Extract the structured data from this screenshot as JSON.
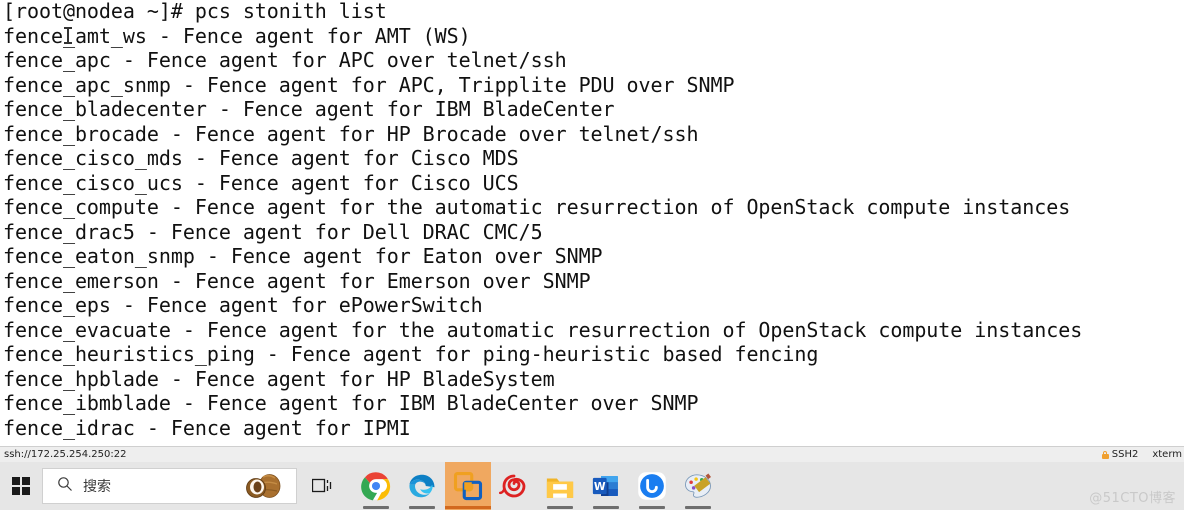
{
  "terminal": {
    "prompt_line": "[root@nodea ~]# pcs stonith list",
    "lines": [
      "[root@nodea ~]# pcs stonith list",
      "fence_amt_ws - Fence agent for AMT (WS)",
      "fence_apc - Fence agent for APC over telnet/ssh",
      "fence_apc_snmp - Fence agent for APC, Tripplite PDU over SNMP",
      "fence_bladecenter - Fence agent for IBM BladeCenter",
      "fence_brocade - Fence agent for HP Brocade over telnet/ssh",
      "fence_cisco_mds - Fence agent for Cisco MDS",
      "fence_cisco_ucs - Fence agent for Cisco UCS",
      "fence_compute - Fence agent for the automatic resurrection of OpenStack compute instances",
      "fence_drac5 - Fence agent for Dell DRAC CMC/5",
      "fence_eaton_snmp - Fence agent for Eaton over SNMP",
      "fence_emerson - Fence agent for Emerson over SNMP",
      "fence_eps - Fence agent for ePowerSwitch",
      "fence_evacuate - Fence agent for the automatic resurrection of OpenStack compute instances",
      "fence_heuristics_ping - Fence agent for ping-heuristic based fencing",
      "fence_hpblade - Fence agent for HP BladeSystem",
      "fence_ibmblade - Fence agent for IBM BladeCenter over SNMP",
      "fence_idrac - Fence agent for IPMI"
    ],
    "background_color": "#ffffff",
    "text_color": "#111111"
  },
  "status_bar": {
    "connection_url": "ssh://172.25.254.250:22",
    "protocol": "SSH2",
    "terminal_type": "xterm",
    "lock_icon_color": "#f0a030"
  },
  "taskbar": {
    "start_label": "Start",
    "search": {
      "placeholder": "搜索",
      "value": ""
    },
    "task_view_label": "Task View",
    "apps": [
      {
        "name": "chrome",
        "label": "Google Chrome",
        "active": false,
        "running": true
      },
      {
        "name": "edge",
        "label": "Microsoft Edge",
        "active": false,
        "running": true
      },
      {
        "name": "xshell",
        "label": "Xshell",
        "active": true,
        "running": true
      },
      {
        "name": "snail",
        "label": "Snail Browser",
        "active": false,
        "running": false
      },
      {
        "name": "file-explorer",
        "label": "File Explorer",
        "active": false,
        "running": true
      },
      {
        "name": "word",
        "label": "Microsoft Word",
        "active": false,
        "running": true
      },
      {
        "name": "wechat",
        "label": "WeChat",
        "active": false,
        "running": true
      },
      {
        "name": "paint",
        "label": "Paint",
        "active": false,
        "running": true
      }
    ],
    "background_color": "#e6e6e6",
    "active_highlight_color": "#f0a860"
  },
  "watermark": {
    "text": "@51CTO博客"
  }
}
